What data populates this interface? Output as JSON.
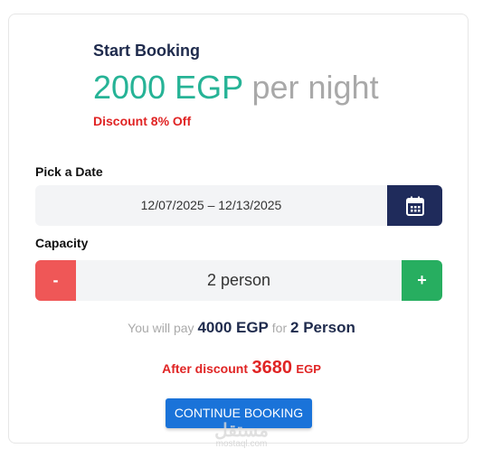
{
  "booking": {
    "heading": "Start Booking",
    "price_amount": "2000 EGP",
    "price_suffix": "per night",
    "discount_text": "Discount 8% Off",
    "date_label": "Pick a Date",
    "date_range": "12/07/2025 – 12/13/2025",
    "capacity_label": "Capacity",
    "minus_label": "-",
    "plus_label": "+",
    "capacity_value": "2 person",
    "pay": {
      "prefix": "You will pay",
      "amount": "4000 EGP",
      "mid": "for",
      "persons": "2 Person"
    },
    "after": {
      "label": "After discount",
      "amount": "3680",
      "currency": "EGP"
    },
    "continue_label": "CONTINUE BOOKING"
  },
  "watermark": {
    "logo_text": "مستقل",
    "site": "mostaql.com"
  },
  "colors": {
    "accent_green": "#26b396",
    "discount_red": "#e02424",
    "navy": "#1f2b5b",
    "button_blue": "#1a73d9",
    "minus_red": "#ef5757",
    "plus_green": "#27ae60"
  },
  "icons": {
    "calendar": "calendar-icon"
  }
}
